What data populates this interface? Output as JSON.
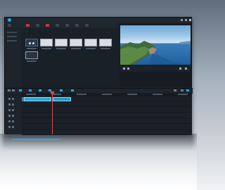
{
  "app": {
    "title": "",
    "menu": [
      "",
      "",
      "",
      "",
      ""
    ]
  },
  "media_tabs": {
    "active": "",
    "secondary": ""
  },
  "media": {
    "thumbnails": [
      {
        "kind": "add"
      },
      {
        "kind": "light"
      },
      {
        "kind": "light"
      },
      {
        "kind": "light"
      },
      {
        "kind": "light"
      },
      {
        "kind": "light"
      }
    ]
  },
  "preview": {
    "header": [
      "",
      "",
      ""
    ],
    "scene": "coastal-cliffs-ocean"
  },
  "timeline": {
    "tracks": [
      {
        "label": "",
        "icon": "video-track-icon"
      },
      {
        "label": "",
        "icon": "video-track-icon"
      },
      {
        "label": "",
        "icon": "audio-track-icon"
      },
      {
        "label": "",
        "icon": "audio-track-icon"
      },
      {
        "label": "",
        "icon": "text-track-icon"
      },
      {
        "label": "",
        "icon": "music-track-icon"
      }
    ],
    "clips": [
      {
        "track": 0,
        "label": "",
        "kind": "video"
      },
      {
        "track": 0,
        "label": "",
        "kind": "video2"
      }
    ]
  },
  "colors": {
    "accent": "#27a8e0",
    "playhead": "#e14a4a",
    "window_bg": "#1b2129"
  }
}
